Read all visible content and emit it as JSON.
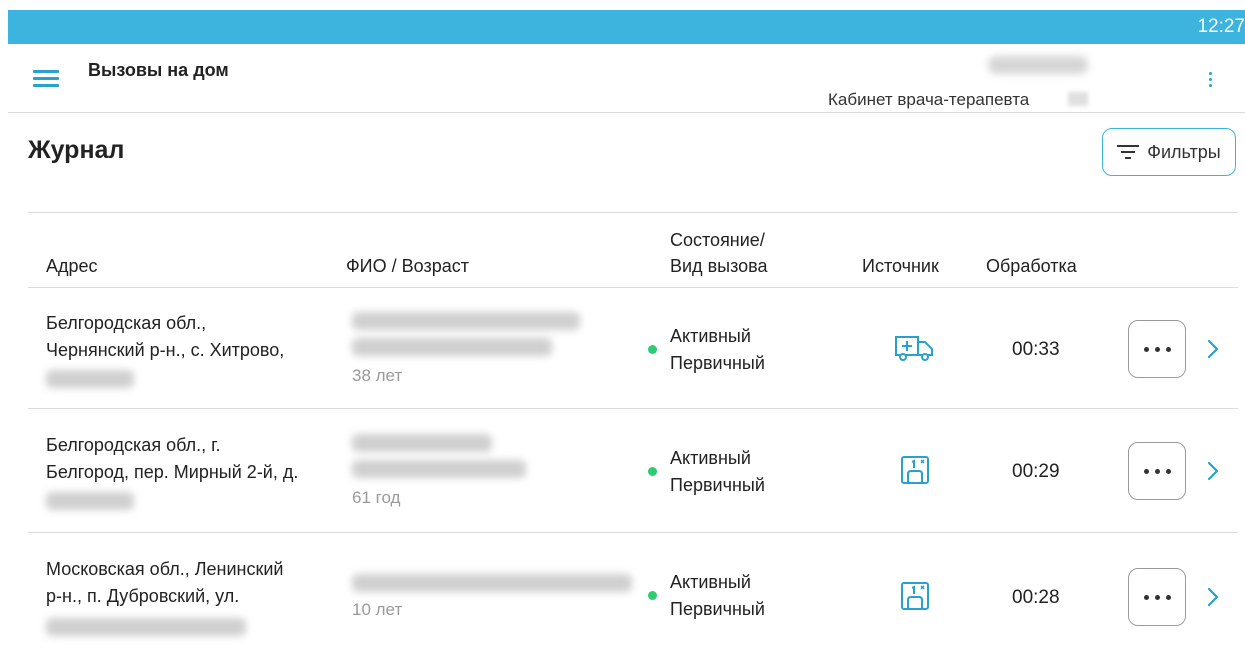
{
  "status_bar": {
    "time": "12:27"
  },
  "app_bar": {
    "title": "Вызовы на дом",
    "cabinet": "Кабинет врача-терапевта"
  },
  "page": {
    "title": "Журнал",
    "filters_label": "Фильтры"
  },
  "table": {
    "headers": {
      "address": "Адрес",
      "fio_age": "ФИО / Возраст",
      "state_line1": "Состояние/",
      "state_line2": "Вид вызова",
      "source": "Источник",
      "processing": "Обработка"
    },
    "rows": [
      {
        "address_line1": "Белгородская обл.,",
        "address_line2": "Чернянский р-н., с. Хитрово,",
        "age": "38 лет",
        "state": "Активный",
        "call_type": "Первичный",
        "source_icon": "ambulance-icon",
        "processing": "00:33"
      },
      {
        "address_line1": "Белгородская обл., г.",
        "address_line2": "Белгород, пер. Мирный 2-й, д.",
        "age": "61 год",
        "state": "Активный",
        "call_type": "Первичный",
        "source_icon": "registry-icon",
        "processing": "00:29"
      },
      {
        "address_line1": "Московская обл., Ленинский",
        "address_line2": "р-н., п. Дубровский, ул.",
        "age": "10 лет",
        "state": "Активный",
        "call_type": "Первичный",
        "source_icon": "registry-icon",
        "processing": "00:28"
      }
    ]
  },
  "colors": {
    "status_bar": "#3db4dd",
    "accent": "#2aa0cf",
    "active_dot": "#2ecc71"
  }
}
